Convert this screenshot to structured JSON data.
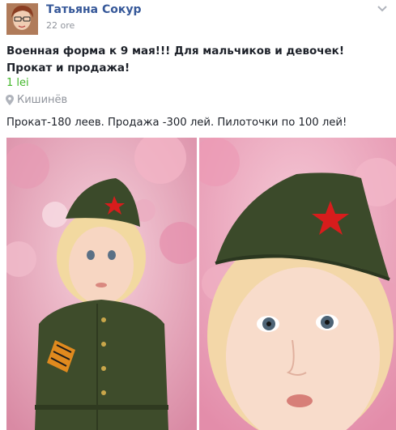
{
  "post": {
    "author": "Татьяна Сокур",
    "time": "22 ore",
    "title": "Военная форма к 9 мая!!! Для мальчиков и девочек! Прокат и продажа!",
    "price": "1 lei",
    "location": "Кишинёв",
    "description": "Прокат-180 леев. Продажа -300 лей. Пилоточки по 100 лей!"
  },
  "icons": {
    "avatar": "avatar",
    "menu": "chevron-down-icon",
    "location": "location-pin-icon"
  },
  "colors": {
    "author_link": "#365899",
    "price": "#42b72a",
    "secondary_text": "#90949c",
    "uniform_green": "#3b4a2a",
    "star_red": "#d81c1c"
  }
}
